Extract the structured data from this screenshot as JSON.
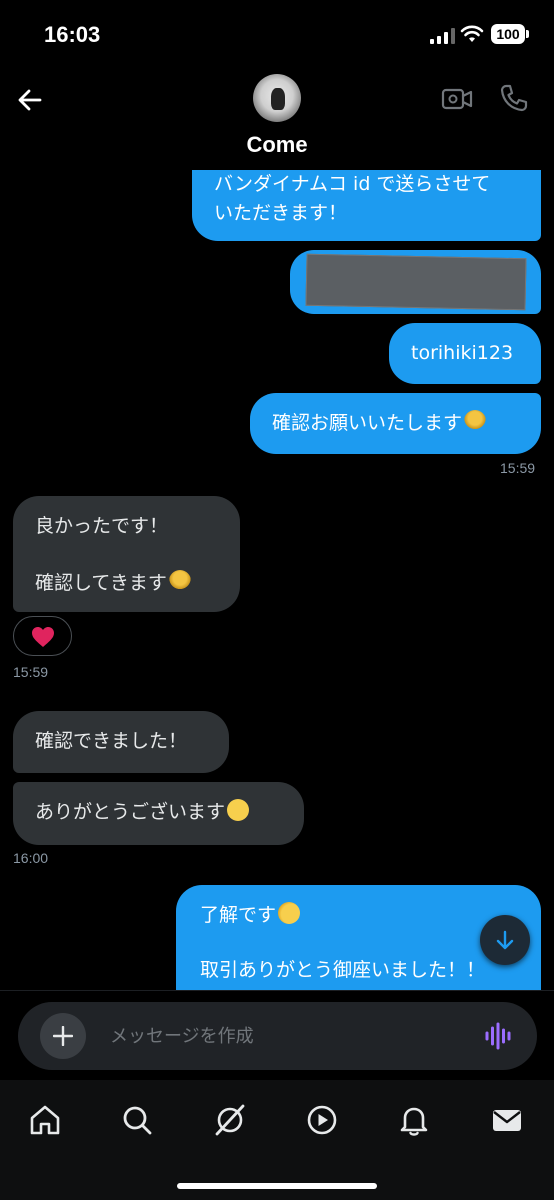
{
  "status_bar": {
    "time": "16:03",
    "battery": "100"
  },
  "header": {
    "contact_name": "Come"
  },
  "messages": [
    {
      "id": "m1",
      "direction": "outgoing",
      "lines": [
        "バンダイナムコ id で送らさせて",
        "いただきます！"
      ]
    },
    {
      "id": "m2",
      "direction": "outgoing",
      "type": "redacted-image"
    },
    {
      "id": "m3",
      "direction": "outgoing",
      "text": "torihiki123"
    },
    {
      "id": "m4",
      "direction": "outgoing",
      "text": "確認お願いいたします",
      "emoji": "bowing-person"
    },
    {
      "id": "m5",
      "direction": "incoming",
      "lines": [
        "良かったです！",
        "確認してきます"
      ],
      "emoji": "bowing-person",
      "reaction": "❤️"
    },
    {
      "id": "m6",
      "direction": "incoming",
      "text": "確認できました！"
    },
    {
      "id": "m7",
      "direction": "incoming",
      "text": "ありがとうございます",
      "emoji": "smiling-face-with-tear"
    },
    {
      "id": "m8",
      "direction": "outgoing",
      "lines": [
        "了解です",
        "取引ありがとう御座いました！！"
      ],
      "emoji": "saluting-face"
    }
  ],
  "timestamps": [
    "15:59",
    "15:59",
    "16:00"
  ],
  "composer": {
    "placeholder": "メッセージを作成"
  },
  "tabs": [
    "home-icon",
    "search-icon",
    "grok-icon",
    "video-icon",
    "notifications-icon",
    "messages-icon"
  ],
  "colors": {
    "outgoing_bubble": "#1d9bf0",
    "incoming_bubble": "#2f3336",
    "voice_accent": "#9b6dff"
  }
}
